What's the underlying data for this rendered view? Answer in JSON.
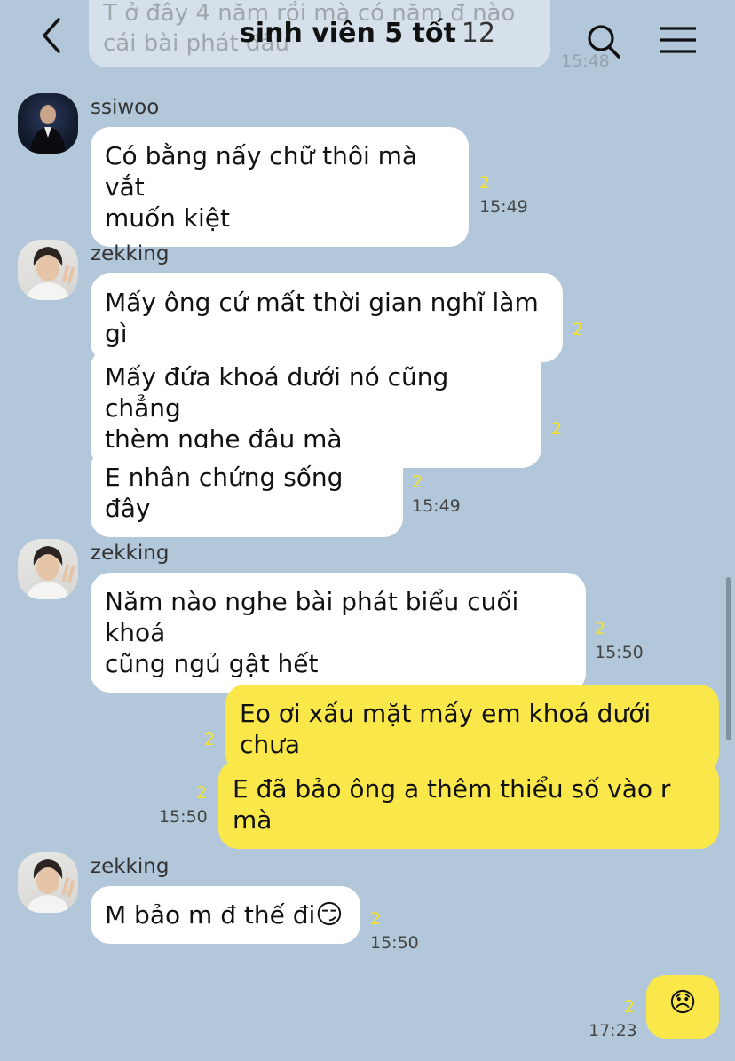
{
  "header": {
    "title": "sinh viên 5 tốt",
    "member_count": "12"
  },
  "ghost_message": {
    "text": "T ở đây 4 năm rồi mà có năm đ nào\ncái bài phát                        đâu",
    "time": "15:48"
  },
  "messages": [
    {
      "sender": "ssiwoo",
      "bubbles": [
        "Có bằng nấy chữ thôi mà vắt\nmuốn kiệt"
      ],
      "read": "2",
      "time": "15:49"
    },
    {
      "sender": "zekking",
      "bubbles": [
        "Mấy ông cứ mất thời gian nghĩ làm gì",
        "Mấy đứa khoá dưới nó cũng chẳng\nthèm nghe đâu mà",
        "E nhân chứng sống đây"
      ],
      "reads": [
        "2",
        "2",
        "2"
      ],
      "time": "15:49"
    },
    {
      "sender": "zekking",
      "bubbles": [
        "Năm nào nghe bài phát biểu cuối khoá\ncũng ngủ gật hết"
      ],
      "read": "2",
      "time": "15:50"
    },
    {
      "sender": "me",
      "bubbles": [
        "Eo ơi xấu mặt mấy em khoá dưới chưa",
        "E đã bảo ông a thêm thiểu số vào r mà"
      ],
      "reads": [
        "2",
        "2"
      ],
      "time": "15:50"
    },
    {
      "sender": "zekking",
      "bubbles": [
        "M bảo m đ thế đi"
      ],
      "emoji": "😏",
      "read": "2",
      "time": "15:50"
    },
    {
      "sender": "me",
      "emoji": "😞",
      "read": "2",
      "time": "17:23"
    }
  ],
  "colors": {
    "background": "#b2c7d9",
    "my_bubble": "#fae74a",
    "their_bubble": "#ffffff",
    "read_count": "#f5e32a"
  },
  "icons": {
    "back": "chevron-left-icon",
    "search": "search-icon",
    "menu": "hamburger-menu-icon"
  }
}
